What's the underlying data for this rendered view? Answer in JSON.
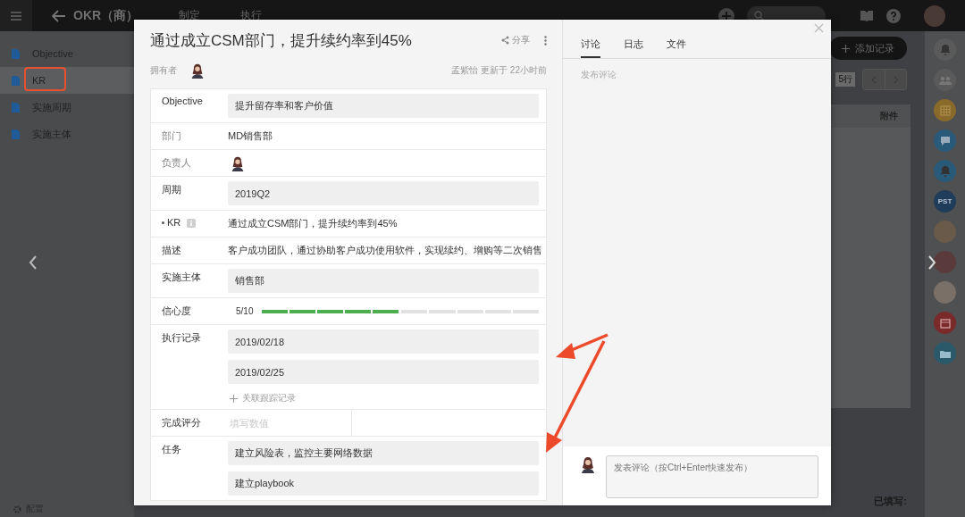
{
  "topbar": {
    "app_title": "OKR（商）",
    "tabs": [
      {
        "label": "制定",
        "selected": false
      },
      {
        "label": "执行",
        "selected": false
      }
    ]
  },
  "sidebar": {
    "items": [
      {
        "label": "Objective",
        "selected": false
      },
      {
        "label": "KR",
        "selected": true
      },
      {
        "label": "实施周期",
        "selected": false
      },
      {
        "label": "实施主体",
        "selected": false
      }
    ],
    "footer": "配置"
  },
  "table_view": {
    "add_button": "添加记录",
    "row_count": "5行",
    "column_header": "附件",
    "filled_label": "已填写:"
  },
  "app_strip": [
    {
      "kind": "bell",
      "color": "#5a5a5a"
    },
    {
      "kind": "team",
      "color": "#5a5a5a"
    },
    {
      "kind": "grid",
      "color": "#8a6a2a"
    },
    {
      "kind": "chat",
      "color": "#2a5a7a"
    },
    {
      "kind": "bell",
      "color": "#2a5a7a"
    },
    {
      "kind": "label",
      "color": "#1f3c5a",
      "text": "PST"
    },
    {
      "kind": "avatar",
      "color": "#6a5a4a"
    },
    {
      "kind": "avatar",
      "color": "#5a3a3a"
    },
    {
      "kind": "avatar",
      "color": "#7a7068"
    },
    {
      "kind": "calendar",
      "color": "#7a2a2a"
    },
    {
      "kind": "folder",
      "color": "#2a5a6a"
    }
  ],
  "record": {
    "title": "通过成立CSM部门，提升续约率到45%",
    "share": "分享",
    "owner_label": "拥有者",
    "updated": "孟紫怡 更新于 22小时前",
    "fields": [
      {
        "kind": "box",
        "label": "Objective",
        "readonly": false,
        "required": false,
        "values": [
          "提升留存率和客户价值"
        ]
      },
      {
        "kind": "text",
        "label": "部门",
        "readonly": true,
        "required": false,
        "value": "MD销售部"
      },
      {
        "kind": "avatar",
        "label": "负责人",
        "readonly": true,
        "required": false
      },
      {
        "kind": "box",
        "label": "周期",
        "readonly": false,
        "required": false,
        "values": [
          "2019Q2"
        ]
      },
      {
        "kind": "text",
        "label": "KR",
        "readonly": false,
        "required": true,
        "value": "通过成立CSM部门，提升续约率到45%"
      },
      {
        "kind": "text",
        "label": "描述",
        "readonly": false,
        "required": false,
        "value": "客户成功团队，通过协助客户成功使用软件，实现续约、增购等二次销售"
      },
      {
        "kind": "box",
        "label": "实施主体",
        "readonly": false,
        "required": false,
        "values": [
          "销售部"
        ]
      },
      {
        "kind": "meter",
        "label": "信心度",
        "readonly": false,
        "required": false,
        "reading": "5/10",
        "level": 0.5
      },
      {
        "kind": "records",
        "label": "执行记录",
        "readonly": false,
        "required": false,
        "values": [
          "2019/02/18",
          "2019/02/25"
        ],
        "link": "关联跟踪记录"
      },
      {
        "kind": "score",
        "label": "完成评分",
        "readonly": false,
        "required": false,
        "placeholder": "填写数值"
      },
      {
        "kind": "box",
        "label": "任务",
        "readonly": false,
        "required": false,
        "values": [
          "建立风险表，监控主要网络数据",
          "建立playbook"
        ]
      }
    ]
  },
  "panel": {
    "tabs": [
      {
        "label": "讨论",
        "selected": true
      },
      {
        "label": "日志",
        "selected": false
      },
      {
        "label": "文件",
        "selected": false
      }
    ],
    "empty_hint": "发布评论",
    "comment_placeholder": "发表评论（按Ctrl+Enter快速发布）"
  }
}
